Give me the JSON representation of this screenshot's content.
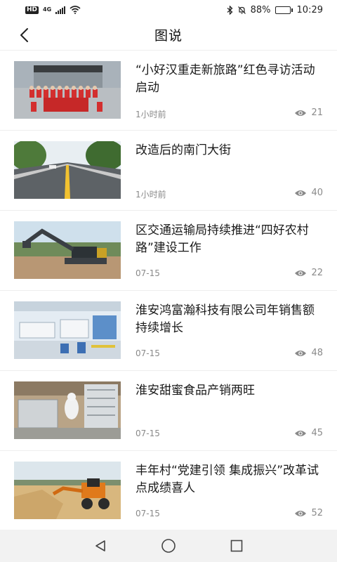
{
  "status": {
    "hd": "HD",
    "net": "4G",
    "battery": "88%",
    "battery_level": 0.88,
    "time": "10:29"
  },
  "header": {
    "title": "图说"
  },
  "articles": [
    {
      "title": "“小好汉重走新旅路”红色寻访活动启动",
      "date": "1小时前",
      "views": "21",
      "thumb": "group-photo"
    },
    {
      "title": "改造后的南门大街",
      "date": "1小时前",
      "views": "40",
      "thumb": "street"
    },
    {
      "title": "区交通运输局持续推进“四好农村路”建设工作",
      "date": "07-15",
      "views": "22",
      "thumb": "excavator"
    },
    {
      "title": "淮安鸿富瀚科技有限公司年销售额持续增长",
      "date": "07-15",
      "views": "48",
      "thumb": "factory-line"
    },
    {
      "title": "淮安甜蜜食品产销两旺",
      "date": "07-15",
      "views": "45",
      "thumb": "food-factory"
    },
    {
      "title": "丰年村“党建引领 集成振兴”改革试点成绩喜人",
      "date": "07-15",
      "views": "52",
      "thumb": "loader"
    }
  ],
  "colors": {
    "divider": "#eeeeee",
    "meta": "#8a8a8a",
    "navbar": "#f2f2f2"
  }
}
